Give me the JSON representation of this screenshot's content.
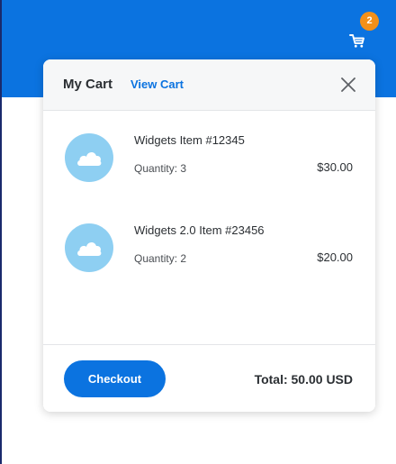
{
  "header": {
    "cart_badge_count": "2",
    "cart_icon": "shopping-cart-icon",
    "brand_color": "#0b73e0",
    "badge_color": "#f39019"
  },
  "cart_popover": {
    "title": "My Cart",
    "view_cart_label": "View Cart",
    "close_icon": "close-icon",
    "items": [
      {
        "name": "Widgets Item #12345",
        "quantity": "Quantity: 3",
        "price": "$30.00",
        "image_icon": "cloud-icon"
      },
      {
        "name": "Widgets 2.0 Item #23456",
        "quantity": "Quantity: 2",
        "price": "$20.00",
        "image_icon": "cloud-icon"
      }
    ],
    "checkout_label": "Checkout",
    "total_label": "Total: 50.00 USD"
  }
}
